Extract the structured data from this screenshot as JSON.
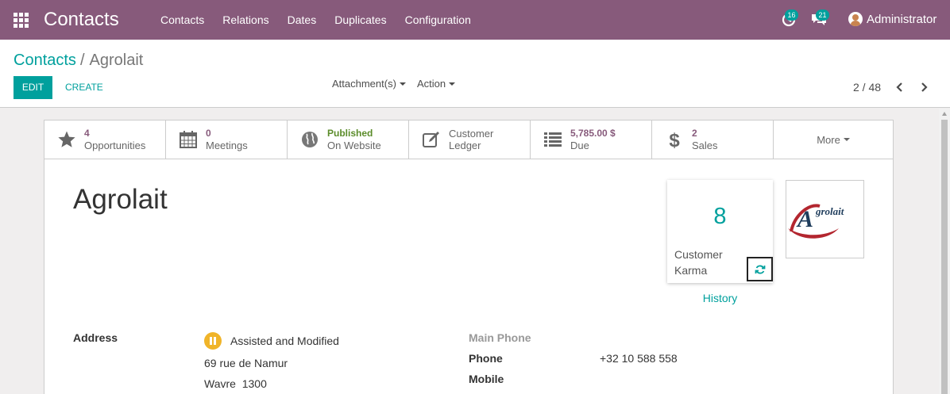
{
  "navbar": {
    "app_title": "Contacts",
    "menu": [
      "Contacts",
      "Relations",
      "Dates",
      "Duplicates",
      "Configuration"
    ],
    "activity_count": "16",
    "messages_count": "21",
    "user_name": "Administrator",
    "colors": {
      "bar": "#875a7b",
      "badge": "#00a09d"
    }
  },
  "control_panel": {
    "breadcrumb_parent": "Contacts",
    "breadcrumb_sep": "/",
    "breadcrumb_current": "Agrolait",
    "edit_label": "EDIT",
    "create_label": "CREATE",
    "attachments_label": "Attachment(s)",
    "action_label": "Action",
    "pager": "2 / 48"
  },
  "stat_buttons": [
    {
      "icon": "star-icon",
      "value": "4",
      "label": "Opportunities"
    },
    {
      "icon": "calendar-icon",
      "value": "0",
      "label": "Meetings"
    },
    {
      "icon": "globe-icon",
      "value": "Published",
      "label": "On Website"
    },
    {
      "icon": "edit-icon",
      "value": "Customer",
      "label": "Ledger"
    },
    {
      "icon": "list-icon",
      "value": "5,785.00 $",
      "label": "Due"
    },
    {
      "icon": "dollar-icon",
      "value": "2",
      "label": "Sales"
    }
  ],
  "more_label": "More",
  "partner": {
    "name": "Agrolait",
    "karma_value": "8",
    "karma_label_1": "Customer",
    "karma_label_2": "Karma",
    "history_label": "History",
    "logo_text": "Agrolait"
  },
  "fields": {
    "address_label": "Address",
    "address_status": "Assisted and Modified",
    "street": "69 rue de Namur",
    "city": "Wavre",
    "zip": "1300",
    "main_phone_label": "Main Phone",
    "phone_label": "Phone",
    "phone_value": "+32 10 588 558",
    "mobile_label": "Mobile"
  }
}
